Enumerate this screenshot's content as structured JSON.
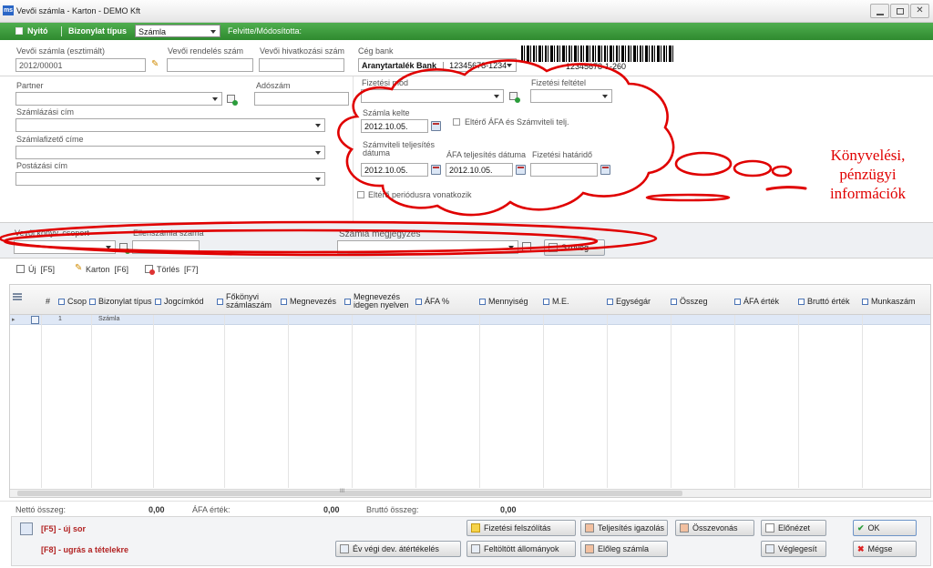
{
  "window": {
    "title": "Vevői számla - Karton - DEMO Kft",
    "app_icon": "ms",
    "controls": [
      "minimize",
      "maximize",
      "close"
    ]
  },
  "toolbar": {
    "nyito_label": "Nyitó",
    "bizonylat_label": "Bizonylat típus",
    "bizonylat_value": "Számla",
    "felvitte_label": "Felvitte/Módosította:"
  },
  "form": {
    "vevoi_szamla_label": "Vevői számla (esztimált)",
    "vevoi_szamla_value": "2012/00001",
    "vevoi_rendeles_label": "Vevői rendelés szám",
    "vevoi_hivatkozasi_label": "Vevői hivatkozási szám",
    "ceg_bank_label": "Cég bank",
    "ceg_bank_name": "Aranytartalék Bank",
    "ceg_bank_account": "12345678-1234",
    "barcode_text": "12345678-1-260",
    "partner_label": "Partner",
    "adoszam_label": "Adószám",
    "szamlazasi_cim_label": "Számlázási cím",
    "szamlafizeto_cime_label": "Számlafizető címe",
    "postazasi_cim_label": "Postázási  cím",
    "fizetesi_mod_label": "Fizetési mód",
    "fizetesi_feltetel_label": "Fizetési feltétel",
    "szamla_kelte_label": "Számla kelte",
    "szamla_kelte_value": "2012.10.05.",
    "elt_afa_label": "Eltérő ÁFA és Számviteli telj.",
    "szamviteli_telj_label": "Számviteli teljesítés dátuma",
    "szamviteli_telj_value": "2012.10.05.",
    "afa_telj_label": "ÁFA teljesítés dátuma",
    "afa_telj_value": "2012.10.05.",
    "fizetesi_hatarido_label": "Fizetési határidő",
    "elt_periodus_label": "Eltérő periódusra vonatkozik"
  },
  "lower": {
    "vevo_konyv_label": "Vevői könyv. csoport",
    "ellenszamla_label": "Ellenszámla száma",
    "szamla_megj_label": "Számla megjegyzés",
    "szoveg_btn_label": "Szöveg"
  },
  "annotation": {
    "line1": "Könyvelési,",
    "line2": "pénzügyi",
    "line3": "információk",
    "color": "#e00000"
  },
  "item_toolbar": {
    "uj": "Új  [F5]",
    "karton": "Karton  [F6]",
    "torles": "Törlés  [F7]"
  },
  "grid": {
    "columns": [
      "#",
      "Csop",
      "Bizonylat típus",
      "Jogcímkód",
      "Főkönyvi számlaszám",
      "Megnevezés",
      "Megnevezés idegen nyelven",
      "ÁFA %",
      "Mennyiség",
      "M.E.",
      "Egységár",
      "Összeg",
      "ÁFA érték",
      "Bruttó érték",
      "Munkaszám"
    ],
    "rows": [
      {
        "num": "1",
        "type": "Számla"
      }
    ],
    "scroll_marker": "III"
  },
  "totals": {
    "netto_label": "Nettó összeg:",
    "netto_value": "0,00",
    "afa_label": "ÁFA érték:",
    "afa_value": "0,00",
    "brutto_label": "Bruttó összeg:",
    "brutto_value": "0,00"
  },
  "footer": {
    "hint1": "[F5] - új sor",
    "hint2": "[F8] - ugrás a tételekre",
    "btn_ev_vegi": "Év végi dev. átértékelés",
    "btn_fizetesi_felsz": "Fizetési felszólítás",
    "btn_feltoltott": "Feltöltött állományok",
    "btn_teljesites": "Teljesítés igazolás",
    "btn_eloleg": "Előleg számla",
    "btn_osszevonas": "Összevonás",
    "btn_elonezet": "Előnézet",
    "btn_veglegesit": "Véglegesít",
    "btn_ok": "OK",
    "btn_megse": "Mégse"
  },
  "colors": {
    "toolbar_green": "#3a9b3a",
    "annotation_red": "#e00000",
    "hint_red": "#b22222"
  }
}
